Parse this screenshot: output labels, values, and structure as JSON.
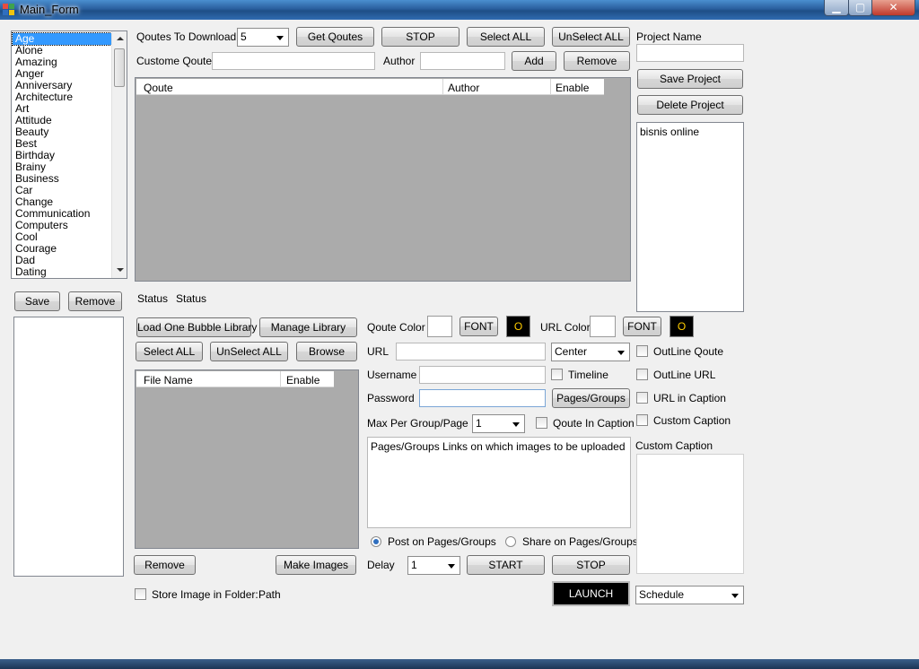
{
  "window": {
    "title": "Main_Form",
    "controls": {
      "minimize": "▁",
      "maximize": "▢",
      "close": "✕"
    }
  },
  "categories": {
    "selected": "Age",
    "items": [
      "Age",
      "Alone",
      "Amazing",
      "Anger",
      "Anniversary",
      "Architecture",
      "Art",
      "Attitude",
      "Beauty",
      "Best",
      "Birthday",
      "Brainy",
      "Business",
      "Car",
      "Change",
      "Communication",
      "Computers",
      "Cool",
      "Courage",
      "Dad",
      "Dating"
    ]
  },
  "left": {
    "save": "Save",
    "remove": "Remove"
  },
  "quotes": {
    "to_download_label": "Qoutes To Download",
    "to_download_value": "5",
    "get_quotes": "Get Qoutes",
    "stop": "STOP",
    "select_all": "Select ALL",
    "unselect_all": "UnSelect ALL",
    "custom_quote_label": "Custome Qoute",
    "author_label": "Author",
    "add": "Add",
    "remove": "Remove",
    "columns": [
      "Qoute",
      "Author",
      "Enable"
    ]
  },
  "project": {
    "name_label": "Project Name",
    "save": "Save Project",
    "delete": "Delete Project",
    "items": [
      "bisnis online"
    ]
  },
  "status": {
    "label": "Status",
    "value": "Status"
  },
  "library": {
    "load_bubble": "Load One Bubble Library",
    "manage": "Manage Library",
    "select_all": "Select ALL",
    "unselect_all": "UnSelect ALL",
    "browse": "Browse",
    "columns": [
      "File Name",
      "Enable"
    ],
    "remove": "Remove",
    "make_images": "Make Images",
    "store_folder_label": "Store Image in Folder:",
    "path": "Path"
  },
  "styling": {
    "quote_color_label": "Qoute Color",
    "url_color_label": "URL Color",
    "font": "FONT",
    "o_glyph": "O",
    "o_color": "#ffcc00"
  },
  "posting": {
    "url_label": "URL",
    "align_value": "Center",
    "username_label": "Username",
    "timeline_label": "Timeline",
    "password_label": "Password",
    "pages_groups": "Pages/Groups",
    "max_label": "Max Per Group/Page",
    "max_value": "1",
    "quote_caption_label": "Qoute In Caption",
    "links_text": "Pages/Groups Links on which images to be uploaded",
    "post_radio": "Post on Pages/Groups",
    "share_radio": "Share on Pages/Groups",
    "delay_label": "Delay",
    "delay_value": "1",
    "start": "START",
    "stop": "STOP",
    "launch": "LAUNCH"
  },
  "options": {
    "outline_quote": "OutLine Qoute",
    "outline_url": "OutLine URL",
    "url_caption": "URL in Caption",
    "custom_caption": "Custom Caption",
    "custom_caption_label": "Custom Caption",
    "schedule_value": "Schedule"
  }
}
